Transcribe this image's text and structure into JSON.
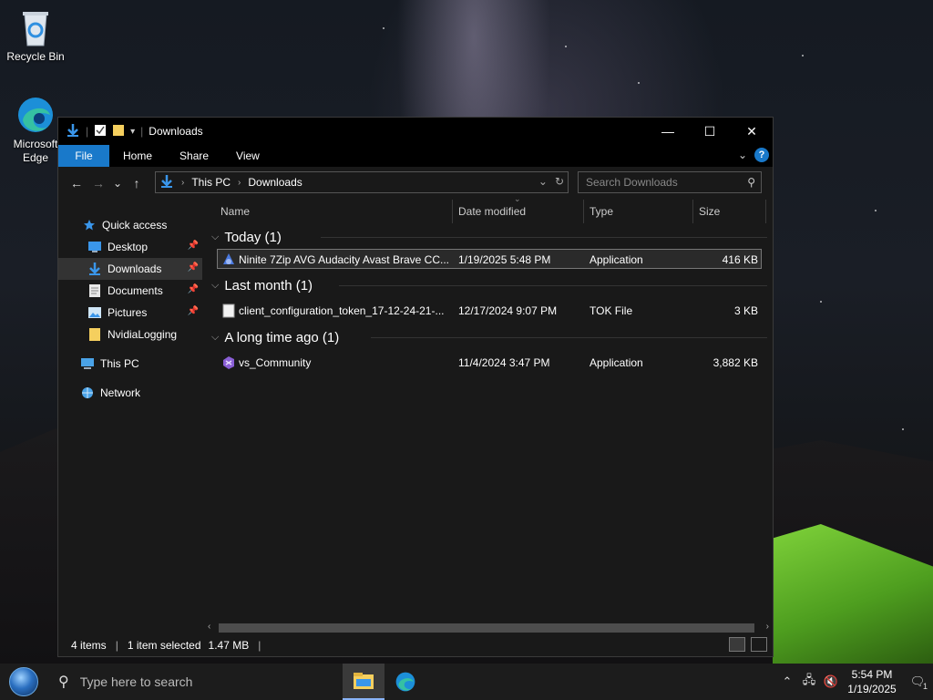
{
  "desktop": {
    "icons": [
      {
        "label": "Recycle Bin"
      },
      {
        "label": "Microsoft Edge"
      }
    ]
  },
  "window": {
    "title": "Downloads",
    "controls": {
      "minimize": "—",
      "maximize": "☐",
      "close": "✕"
    }
  },
  "ribbon": {
    "tabs": [
      "File",
      "Home",
      "Share",
      "View"
    ],
    "help": "?"
  },
  "navbar": {
    "back": "←",
    "forward": "→",
    "recent": "⌄",
    "up": "↑",
    "breadcrumbs": [
      "This PC",
      "Downloads"
    ],
    "search_placeholder": "Search Downloads"
  },
  "sidebar": {
    "items": [
      {
        "label": "Quick access",
        "icon": "star-icon"
      },
      {
        "label": "Desktop",
        "icon": "desktop-icon",
        "pinned": true
      },
      {
        "label": "Downloads",
        "icon": "download-icon",
        "pinned": true,
        "selected": true
      },
      {
        "label": "Documents",
        "icon": "documents-icon",
        "pinned": true
      },
      {
        "label": "Pictures",
        "icon": "pictures-icon",
        "pinned": true
      },
      {
        "label": "NvidiaLogging",
        "icon": "folder-icon"
      },
      {
        "label": "This PC",
        "icon": "computer-icon"
      },
      {
        "label": "Network",
        "icon": "network-icon"
      }
    ]
  },
  "columns": [
    "Name",
    "Date modified",
    "Type",
    "Size"
  ],
  "groups": [
    {
      "label": "Today (1)",
      "files": [
        {
          "name": "Ninite 7Zip AVG Audacity Avast Brave CC...",
          "date": "1/19/2025 5:48 PM",
          "type": "Application",
          "size": "416 KB",
          "selected": true
        }
      ]
    },
    {
      "label": "Last month (1)",
      "files": [
        {
          "name": "client_configuration_token_17-12-24-21-...",
          "date": "12/17/2024 9:07 PM",
          "type": "TOK File",
          "size": "3 KB"
        }
      ]
    },
    {
      "label": "A long time ago (1)",
      "files": [
        {
          "name": "vs_Community",
          "date": "11/4/2024 3:47 PM",
          "type": "Application",
          "size": "3,882 KB"
        }
      ]
    }
  ],
  "status": {
    "items": "4 items",
    "selected": "1 item selected",
    "size": "1.47 MB"
  },
  "taskbar": {
    "search_placeholder": "Type here to search",
    "time": "5:54 PM",
    "date": "1/19/2025",
    "notification_count": "1"
  },
  "colors": {
    "accent": "#1979ca",
    "window_bg": "#191919",
    "titlebar_bg": "#000000"
  }
}
